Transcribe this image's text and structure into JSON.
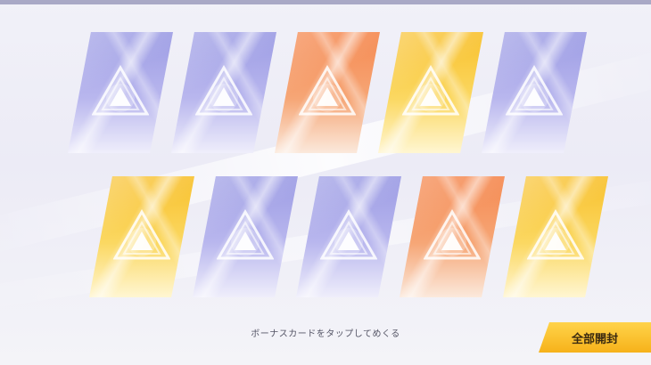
{
  "hint_text": "ボーナスカードをタップしてめくる",
  "open_all_label": "全部開封",
  "colors": {
    "purple": "#a9a8ea",
    "orange": "#f6935f",
    "gold": "#fbcc3e",
    "button": "#f8c12c"
  },
  "rows": [
    [
      "purple",
      "purple",
      "orange",
      "gold",
      "purple"
    ],
    [
      "gold",
      "purple",
      "purple",
      "orange",
      "gold"
    ]
  ]
}
